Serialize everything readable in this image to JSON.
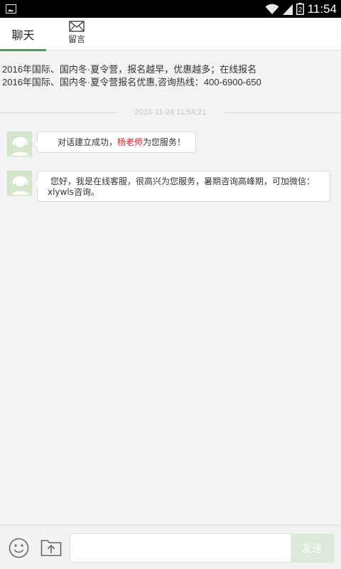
{
  "status_bar": {
    "time": "11:54",
    "battery_level": "2"
  },
  "tabs": {
    "chat_label": "聊天",
    "message_label": "留言"
  },
  "notice": {
    "line1": "2016年国际、国内冬·夏令营，报名越早，优惠越多；在线报名",
    "line2": "2016年国际、国内冬·夏令营报名优惠,咨询热线：400-6900-650"
  },
  "chat": {
    "timestamp": "2016-11-24 11:54:21",
    "messages": [
      {
        "prefix": "对话建立成功，",
        "highlight": "杨老师",
        "suffix": "为您服务！"
      },
      {
        "line1": "您好，我是在线客服，很高兴为您服务，暑期咨询高峰期，可加微信：",
        "line2": "xlywls咨询。"
      }
    ]
  },
  "composer": {
    "input_value": "",
    "input_placeholder": "",
    "send_label": "发送"
  },
  "colors": {
    "accent": "#4a9c5d",
    "highlight_text": "#e02020",
    "send_button_bg": "#dcebd9"
  }
}
